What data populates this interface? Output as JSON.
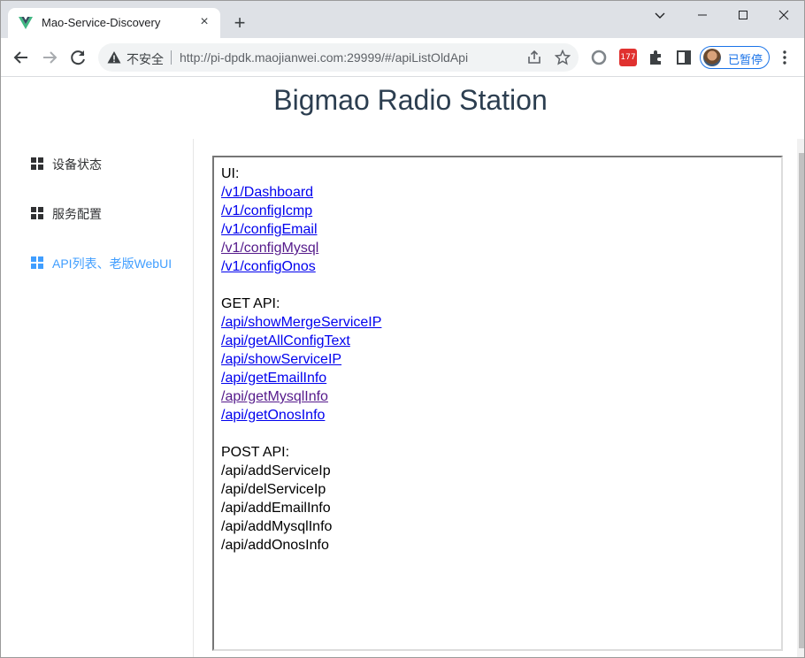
{
  "browser": {
    "tab_title": "Mao-Service-Discovery",
    "insecure_label": "不安全",
    "url": "http://pi-dpdk.maojianwei.com:29999/#/apiListOldApi",
    "extension_badge": "177",
    "profile_label": "已暂停"
  },
  "page": {
    "title": "Bigmao Radio Station"
  },
  "sidebar": {
    "items": [
      {
        "label": "设备状态",
        "active": false
      },
      {
        "label": "服务配置",
        "active": false
      },
      {
        "label": "API列表、老版WebUI",
        "active": true
      }
    ]
  },
  "content": {
    "ui_heading": "UI:",
    "ui_links": [
      {
        "text": "/v1/Dashboard",
        "visited": false
      },
      {
        "text": "/v1/configIcmp",
        "visited": false
      },
      {
        "text": "/v1/configEmail",
        "visited": false
      },
      {
        "text": "/v1/configMysql",
        "visited": true
      },
      {
        "text": "/v1/configOnos",
        "visited": false
      }
    ],
    "get_heading": "GET API:",
    "get_links": [
      {
        "text": "/api/showMergeServiceIP",
        "visited": false
      },
      {
        "text": "/api/getAllConfigText",
        "visited": false
      },
      {
        "text": "/api/showServiceIP",
        "visited": false
      },
      {
        "text": "/api/getEmailInfo",
        "visited": false
      },
      {
        "text": "/api/getMysqlInfo",
        "visited": true
      },
      {
        "text": "/api/getOnosInfo",
        "visited": false
      }
    ],
    "post_heading": "POST API:",
    "post_items": [
      "/api/addServiceIp",
      "/api/delServiceIp",
      "/api/addEmailInfo",
      "/api/addMysqlInfo",
      "/api/addOnosInfo"
    ]
  }
}
